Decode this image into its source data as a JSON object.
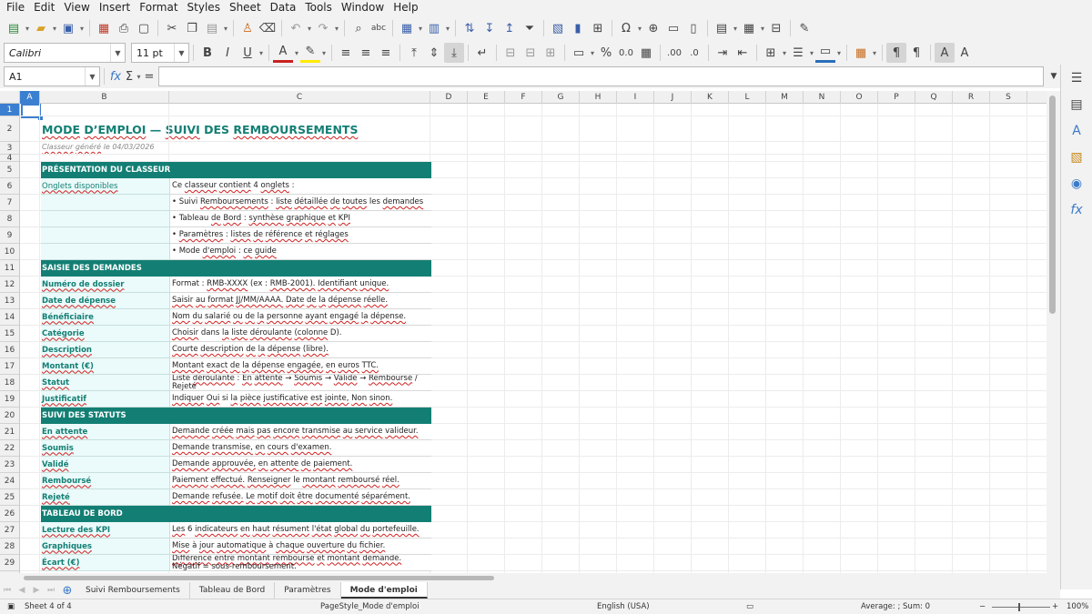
{
  "menu": [
    "File",
    "Edit",
    "View",
    "Insert",
    "Format",
    "Styles",
    "Sheet",
    "Data",
    "Tools",
    "Window",
    "Help"
  ],
  "toolbar": {
    "font_name": "Calibri",
    "font_size": "11 pt"
  },
  "formula": {
    "name_box": "A1",
    "fx_label": "fx",
    "sum_label": "Σ",
    "equals_label": "=",
    "content": ""
  },
  "columns": [
    "A",
    "B",
    "C",
    "D",
    "E",
    "F",
    "G",
    "H",
    "I",
    "J",
    "K",
    "L",
    "M",
    "N",
    "O",
    "P",
    "Q",
    "R",
    "S"
  ],
  "active_column": "A",
  "active_row": "1",
  "sheet": {
    "title": "MODE D’EMPLOI — SUIVI DES REMBOURSEMENTS",
    "subtitle": "Classeur généré le 04/03/2026",
    "sections": [
      {
        "row": 5,
        "text": "PRÉSENTATION DU CLASSEUR"
      },
      {
        "row": 11,
        "text": "SAISIE DES DEMANDES"
      },
      {
        "row": 20,
        "text": "SUIVI DES STATUTS"
      },
      {
        "row": 26,
        "text": "TABLEAU DE BORD"
      }
    ],
    "rows": [
      {
        "row": 6,
        "label": "Onglets disponibles",
        "value": "Ce classeur contient 4 onglets :"
      },
      {
        "row": 7,
        "label": "",
        "value": "• Suivi Remboursements : liste détaillée de toutes les demandes"
      },
      {
        "row": 8,
        "label": "",
        "value": "• Tableau de Bord : synthèse graphique et KPI"
      },
      {
        "row": 9,
        "label": "",
        "value": "• Paramètres : listes de référence et réglages"
      },
      {
        "row": 10,
        "label": "",
        "value": "• Mode d'emploi : ce guide"
      },
      {
        "row": 12,
        "label": "Numéro de dossier",
        "value": "Format : RMB-XXXX (ex : RMB-2001). Identifiant unique."
      },
      {
        "row": 13,
        "label": "Date de dépense",
        "value": "Saisir au format JJ/MM/AAAA. Date de la dépense réelle."
      },
      {
        "row": 14,
        "label": "Bénéficiaire",
        "value": "Nom du salarié ou de la personne ayant engagé la dépense."
      },
      {
        "row": 15,
        "label": "Catégorie",
        "value": "Choisir dans la liste déroulante (colonne D)."
      },
      {
        "row": 16,
        "label": "Description",
        "value": "Courte description de la dépense (libre)."
      },
      {
        "row": 17,
        "label": "Montant (€)",
        "value": "Montant exact de la dépense engagée, en euros TTC."
      },
      {
        "row": 18,
        "label": "Statut",
        "value": "Liste déroulante : En attente → Soumis → Validé → Remboursé / Rejeté"
      },
      {
        "row": 19,
        "label": "Justificatif",
        "value": "Indiquer Oui si la pièce justificative est jointe, Non sinon."
      },
      {
        "row": 21,
        "label": "En attente",
        "value": "Demande créée mais pas encore transmise au service valideur."
      },
      {
        "row": 22,
        "label": "Soumis",
        "value": "Demande transmise, en cours d'examen."
      },
      {
        "row": 23,
        "label": "Validé",
        "value": "Demande approuvée, en attente de paiement."
      },
      {
        "row": 24,
        "label": "Remboursé",
        "value": "Paiement effectué. Renseigner le montant remboursé réel."
      },
      {
        "row": 25,
        "label": "Rejeté",
        "value": "Demande refusée. Le motif doit être documenté séparément."
      },
      {
        "row": 27,
        "label": "Lecture des KPI",
        "value": "Les 6 indicateurs en haut résument l'état global du portefeuille."
      },
      {
        "row": 28,
        "label": "Graphiques",
        "value": "Mise à jour automatique à chaque ouverture du fichier."
      },
      {
        "row": 29,
        "label": "Écart (€)",
        "value": "Différence entre montant remboursé et montant demandé. Négatif = sous-remboursement."
      }
    ]
  },
  "tabs": [
    "Suivi Remboursements",
    "Tableau de Bord",
    "Paramètres",
    "Mode d'emploi"
  ],
  "active_tab": "Mode d'emploi",
  "status": {
    "sheet_info": "Sheet 4 of 4",
    "page_style": "PageStyle_Mode d'emploi",
    "language": "English (USA)",
    "summary": "Average: ; Sum: 0",
    "zoom": "100%"
  },
  "colors": {
    "accent": "#137f74",
    "label_bg": "#ebfafa",
    "selection": "#3b7fd1"
  }
}
